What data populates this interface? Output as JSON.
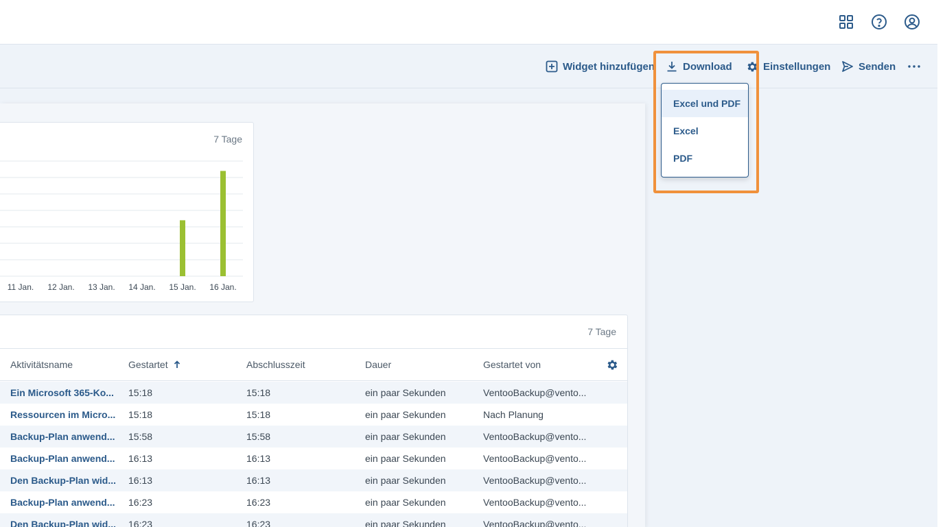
{
  "toolbar": {
    "add_widget": "Widget hinzufügen",
    "download": "Download",
    "settings": "Einstellungen",
    "send": "Senden"
  },
  "download_menu": {
    "items": [
      "Excel und PDF",
      "Excel",
      "PDF"
    ],
    "active_index": 0
  },
  "chart_widget": {
    "period": "7 Tage"
  },
  "chart_data": {
    "type": "bar",
    "categories": [
      "11 Jan.",
      "12 Jan.",
      "13 Jan.",
      "14 Jan.",
      "15 Jan.",
      "16 Jan."
    ],
    "values": [
      0,
      0,
      0,
      0,
      3.4,
      6.4
    ],
    "ylim": [
      0,
      7
    ],
    "grid": true,
    "color": "#9bc032"
  },
  "table_widget": {
    "period": "7 Tage",
    "columns": [
      "Aktivitätsname",
      "Gestartet",
      "Abschlusszeit",
      "Dauer",
      "Gestartet von"
    ],
    "rows": [
      [
        "Ein Microsoft 365-Ko...",
        "15:18",
        "15:18",
        "ein paar Sekunden",
        "VentooBackup@vento..."
      ],
      [
        "Ressourcen im Micro...",
        "15:18",
        "15:18",
        "ein paar Sekunden",
        "Nach Planung"
      ],
      [
        "Backup-Plan anwend...",
        "15:58",
        "15:58",
        "ein paar Sekunden",
        "VentooBackup@vento..."
      ],
      [
        "Backup-Plan anwend...",
        "16:13",
        "16:13",
        "ein paar Sekunden",
        "VentooBackup@vento..."
      ],
      [
        "Den Backup-Plan wid...",
        "16:13",
        "16:13",
        "ein paar Sekunden",
        "VentooBackup@vento..."
      ],
      [
        "Backup-Plan anwend...",
        "16:23",
        "16:23",
        "ein paar Sekunden",
        "VentooBackup@vento..."
      ],
      [
        "Den Backup-Plan wid...",
        "16:23",
        "16:23",
        "ein paar Sekunden",
        "VentooBackup@vento..."
      ]
    ]
  },
  "colors": {
    "accent": "#2b5a8a",
    "highlight": "#f0913c",
    "bar": "#9bc032"
  },
  "icons": {
    "topbar": [
      "apps-grid-icon",
      "help-icon",
      "user-account-icon"
    ],
    "toolbar": [
      "plus-square-icon",
      "download-icon",
      "gear-icon",
      "send-icon",
      "more-icon"
    ],
    "table": [
      "sort-ascending-icon",
      "column-settings-icon"
    ]
  }
}
